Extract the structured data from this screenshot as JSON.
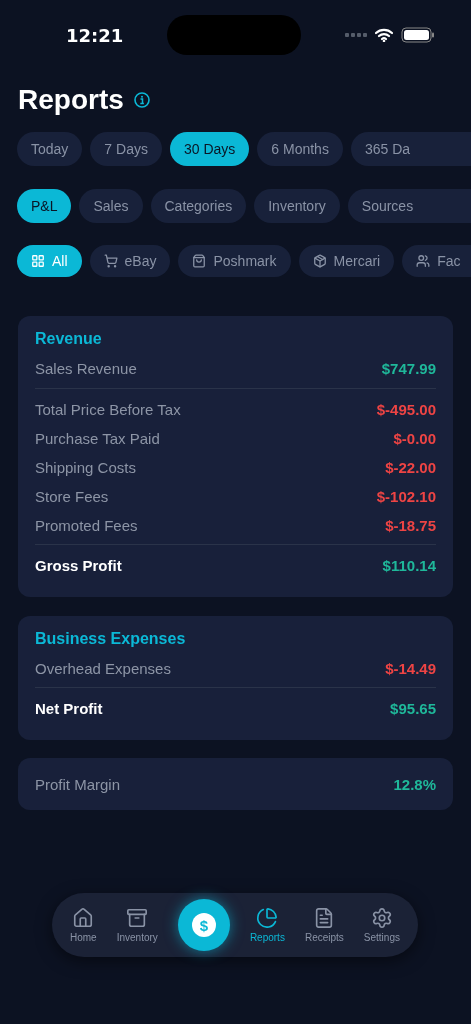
{
  "status_bar": {
    "time": "12:21"
  },
  "title": "Reports",
  "periods": [
    {
      "label": "Today",
      "selected": false
    },
    {
      "label": "7 Days",
      "selected": false
    },
    {
      "label": "30 Days",
      "selected": true
    },
    {
      "label": "6 Months",
      "selected": false
    },
    {
      "label": "365 Da",
      "selected": false
    }
  ],
  "report_tabs": [
    {
      "label": "P&L",
      "selected": true
    },
    {
      "label": "Sales",
      "selected": false
    },
    {
      "label": "Categories",
      "selected": false
    },
    {
      "label": "Inventory",
      "selected": false
    },
    {
      "label": "Sources",
      "selected": false
    }
  ],
  "platforms": [
    {
      "label": "All",
      "selected": true
    },
    {
      "label": "eBay",
      "selected": false
    },
    {
      "label": "Poshmark",
      "selected": false
    },
    {
      "label": "Mercari",
      "selected": false
    },
    {
      "label": "Fac",
      "selected": false
    }
  ],
  "sections": [
    {
      "title": "Revenue",
      "rows": [
        {
          "kind": "item",
          "label": "Sales Revenue",
          "value": "$747.99",
          "negative": false
        },
        {
          "kind": "divider"
        },
        {
          "kind": "item",
          "label": "Total Price Before Tax",
          "value": "$-495.00",
          "negative": true
        },
        {
          "kind": "item",
          "label": "Purchase Tax Paid",
          "value": "$-0.00",
          "negative": true
        },
        {
          "kind": "item",
          "label": "Shipping Costs",
          "value": "$-22.00",
          "negative": true
        },
        {
          "kind": "item",
          "label": "Store Fees",
          "value": "$-102.10",
          "negative": true
        },
        {
          "kind": "item",
          "label": "Promoted Fees",
          "value": "$-18.75",
          "negative": true
        },
        {
          "kind": "total",
          "label": "Gross Profit",
          "value": "$110.14",
          "negative": false
        }
      ]
    },
    {
      "title": "Business Expenses",
      "rows": [
        {
          "kind": "item",
          "label": "Overhead Expenses",
          "value": "$-14.49",
          "negative": true
        },
        {
          "kind": "total",
          "label": "Net Profit",
          "value": "$95.65",
          "negative": false
        }
      ]
    }
  ],
  "margin": {
    "label": "Profit Margin",
    "value": "12.8%"
  },
  "tab_bar": {
    "center_symbol": "$",
    "items": [
      {
        "kind": "tab",
        "label": "Home",
        "selected": false
      },
      {
        "kind": "tab",
        "label": "Inventory",
        "selected": false
      },
      {
        "kind": "center"
      },
      {
        "kind": "tab",
        "label": "Reports",
        "selected": true
      },
      {
        "kind": "tab",
        "label": "Receipts",
        "selected": false
      },
      {
        "kind": "tab",
        "label": "Settings",
        "selected": false
      }
    ]
  }
}
